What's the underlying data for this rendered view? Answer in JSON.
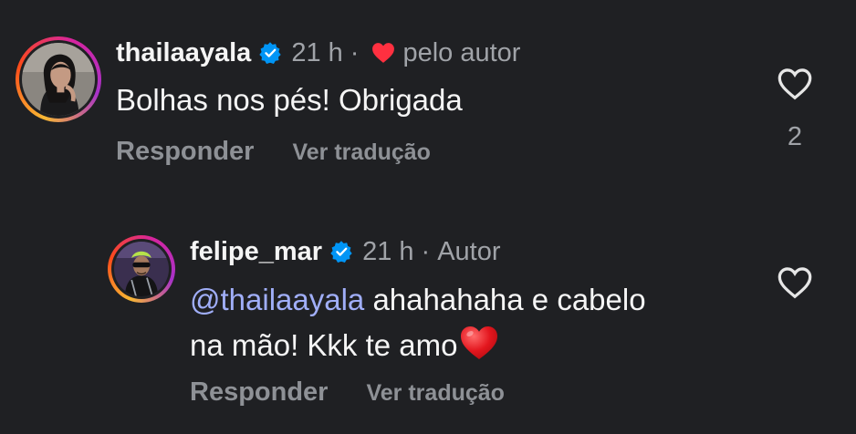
{
  "comments": [
    {
      "username": "thailaayala",
      "verified": true,
      "time": "21 h",
      "separator": "·",
      "liked_by_author": true,
      "byline": "pelo autor",
      "text": "Bolhas nos pés! Obrigada",
      "reply_label": "Responder",
      "translate_label": "Ver tradução",
      "like_count": "2"
    },
    {
      "username": "felipe_mar",
      "verified": true,
      "time": "21 h",
      "separator": "·",
      "byline": "Autor",
      "mention": "@thailaayala",
      "text_line1": " ahahahaha e cabelo",
      "text_line2": "na mão! Kkk te amo",
      "emoji": "red-heart",
      "reply_label": "Responder",
      "translate_label": "Ver tradução"
    }
  ],
  "colors": {
    "background": "#1f2023",
    "primary_text": "#f5f5f5",
    "secondary_text": "#a0a3a8",
    "mention": "#a0aef8",
    "verified_badge": "#0095f6",
    "like_heart": "#ff3040"
  },
  "icons": {
    "verified": "verified-badge-icon",
    "author_like": "heart-filled-icon",
    "like": "heart-outline-icon",
    "emoji": "red-heart-emoji"
  }
}
